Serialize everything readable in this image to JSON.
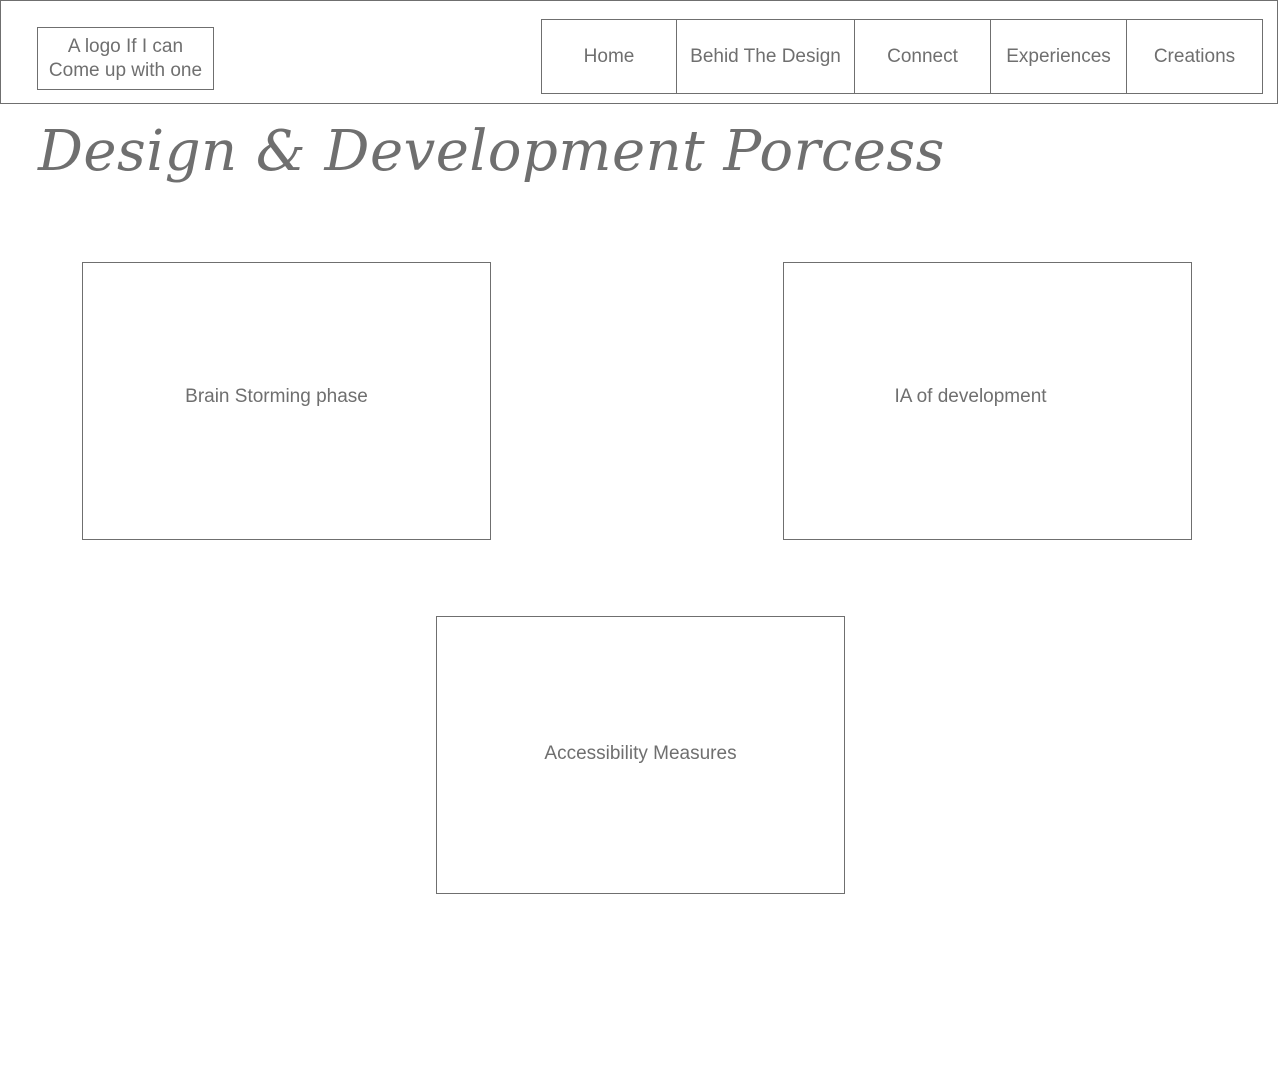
{
  "header": {
    "logo_text": "A logo If I can Come up with one",
    "nav": [
      {
        "label": "Home"
      },
      {
        "label": "Behid The Design"
      },
      {
        "label": "Connect"
      },
      {
        "label": "Experiences"
      },
      {
        "label": "Creations"
      }
    ]
  },
  "main": {
    "title": "Design & Development Porcess",
    "cards": [
      {
        "label": "Brain Storming phase"
      },
      {
        "label": "IA of development"
      },
      {
        "label": "Accessibility Measures"
      }
    ]
  },
  "colors": {
    "line": "#6f6f6f",
    "background": "#ffffff"
  }
}
